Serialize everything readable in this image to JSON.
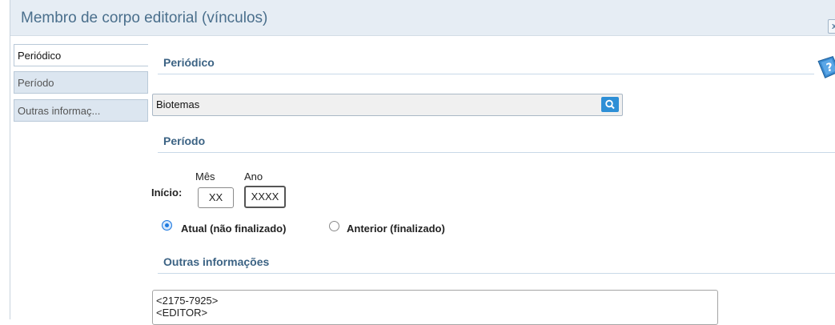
{
  "dialog": {
    "title": "Membro de corpo editorial (vínculos)",
    "close_label": "x"
  },
  "tabs": [
    {
      "label": "Periódico",
      "active": true
    },
    {
      "label": "Período",
      "active": false
    },
    {
      "label": "Outras informaç...",
      "active": false
    }
  ],
  "sections": {
    "periodico": {
      "title": "Periódico",
      "field_value": "Biotemas",
      "search_icon": "search-icon"
    },
    "periodo": {
      "title": "Período",
      "inicio_label": "Início:",
      "mes_label": "Mês",
      "ano_label": "Ano",
      "mes_value": "XX",
      "ano_value": "XXXX",
      "radio_atual_label": "Atual (não finalizado)",
      "radio_anterior_label": "Anterior (finalizado)",
      "selected": "atual"
    },
    "outras": {
      "title": "Outras informações",
      "text_line1": "<2175-7925>",
      "text_line2": "<EDITOR>"
    }
  },
  "colors": {
    "accent": "#3c6384",
    "titlebar": "#e6edf4",
    "search_button": "#2e8fd6",
    "radio_selected": "#1f7ae0"
  },
  "icons": [
    "help-icon",
    "search-icon",
    "close-icon"
  ]
}
